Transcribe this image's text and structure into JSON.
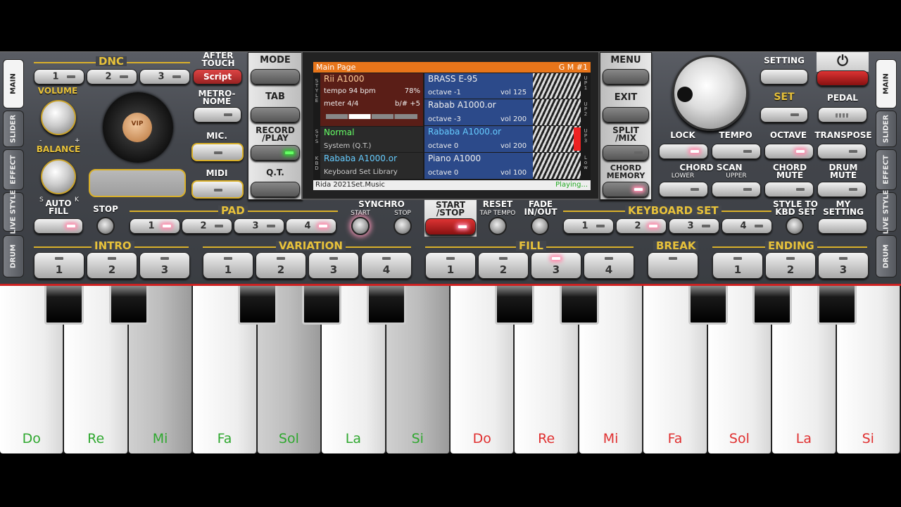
{
  "side_tabs": {
    "main": "MAIN",
    "slider": "SLIDER",
    "effect": "EFFECT",
    "live_style": "LIVE STYLE",
    "drum": "DRUM"
  },
  "dnc": {
    "title": "DNC",
    "buttons": [
      "1",
      "2",
      "3"
    ],
    "after_touch": "AFTER TOUCH",
    "script": "Script"
  },
  "volume": "VOLUME",
  "balance": "BALANCE",
  "balance_s": "S",
  "balance_k": "K",
  "vol_minus": "-",
  "vol_plus": "+",
  "vip": "VIP",
  "metronome": "METRO- NOME",
  "mic": "MIC.",
  "midi": "MIDI",
  "mode": "MODE",
  "tab": "TAB",
  "record_play": "RECORD /PLAY",
  "qt": "Q.T.",
  "screen": {
    "title": "Main Page",
    "gm": "G M #1",
    "style_name": "Rii A1000",
    "tempo": "tempo 94 bpm",
    "percent": "78%",
    "meter": "meter 4/4",
    "transpose": "b/# +5",
    "upper": [
      {
        "name": "BRASS E-95",
        "octave": "octave -1",
        "vol": "vol 125",
        "tag": "U P 1"
      },
      {
        "name": "Rabab A1000.or",
        "octave": "octave -3",
        "vol": "vol 200",
        "tag": "U P 2"
      },
      {
        "name": "Rababa A1000.or",
        "octave": "octave 0",
        "vol": "vol 200",
        "tag": "U P 3"
      },
      {
        "name": "Piano A1000",
        "octave": "octave 0",
        "vol": "vol 100",
        "tag": "L o w"
      }
    ],
    "sys_name": "Normal",
    "sys_sub": "System (Q.T.)",
    "kbd_name": "Rababa A1000.or",
    "kbd_sub": "Keyboard Set Library",
    "footer": "Rida 2021Set.Music",
    "status": "Playing...",
    "style_label": "S T Y L E",
    "sys_label": "S Y S",
    "kbd_label": "K B D"
  },
  "menu": "MENU",
  "exit": "EXIT",
  "split_mix": "SPLIT /MIX",
  "chord_memory": "CHORD MEMORY",
  "setting": "SETTING",
  "set": "SET",
  "pedal": "PEDAL",
  "power_icon": "power-icon",
  "lock": "LOCK",
  "tempo_lbl": "TEMPO",
  "octave": "OCTAVE",
  "transpose": "TRANSPOSE",
  "chord_scan": "CHORD SCAN",
  "lower": "LOWER",
  "upper_lbl": "UPPER",
  "chord_mute": "CHORD MUTE",
  "drum_mute": "DRUM MUTE",
  "auto_fill": "AUTO FILL",
  "stop": "STOP",
  "pad": {
    "title": "PAD",
    "buttons": [
      "1",
      "2",
      "3",
      "4"
    ]
  },
  "synchro": "SYNCHRO",
  "sync_start": "START",
  "sync_stop": "STOP",
  "start_stop": "START /STOP",
  "reset": "RESET",
  "tap_tempo": "TAP TEMPO",
  "fade": "FADE IN/OUT",
  "keyboard_set": {
    "title": "KEYBOARD SET",
    "buttons": [
      "1",
      "2",
      "3",
      "4"
    ]
  },
  "style_to_kbd": "STYLE TO KBD SET",
  "my_setting": "MY SETTING",
  "intro": {
    "title": "INTRO",
    "buttons": [
      "1",
      "2",
      "3"
    ]
  },
  "variation": {
    "title": "VARIATION",
    "buttons": [
      "1",
      "2",
      "3",
      "4"
    ]
  },
  "fill": {
    "title": "FILL",
    "buttons": [
      "1",
      "2",
      "3",
      "4"
    ]
  },
  "break": "BREAK",
  "ending": {
    "title": "ENDING",
    "buttons": [
      "1",
      "2",
      "3"
    ]
  },
  "keys": [
    "Do",
    "Re",
    "Mi",
    "Fa",
    "Sol",
    "La",
    "Si",
    "Do",
    "Re",
    "Mi",
    "Fa",
    "Sol",
    "La",
    "Si"
  ],
  "colors": {
    "accent": "#d9b02a",
    "green_note": "#2fa82f",
    "red_note": "#e03030",
    "screen_title": "#e8751a",
    "style_bg": "#5a1e17",
    "voice_bg": "#2c4a8a"
  }
}
